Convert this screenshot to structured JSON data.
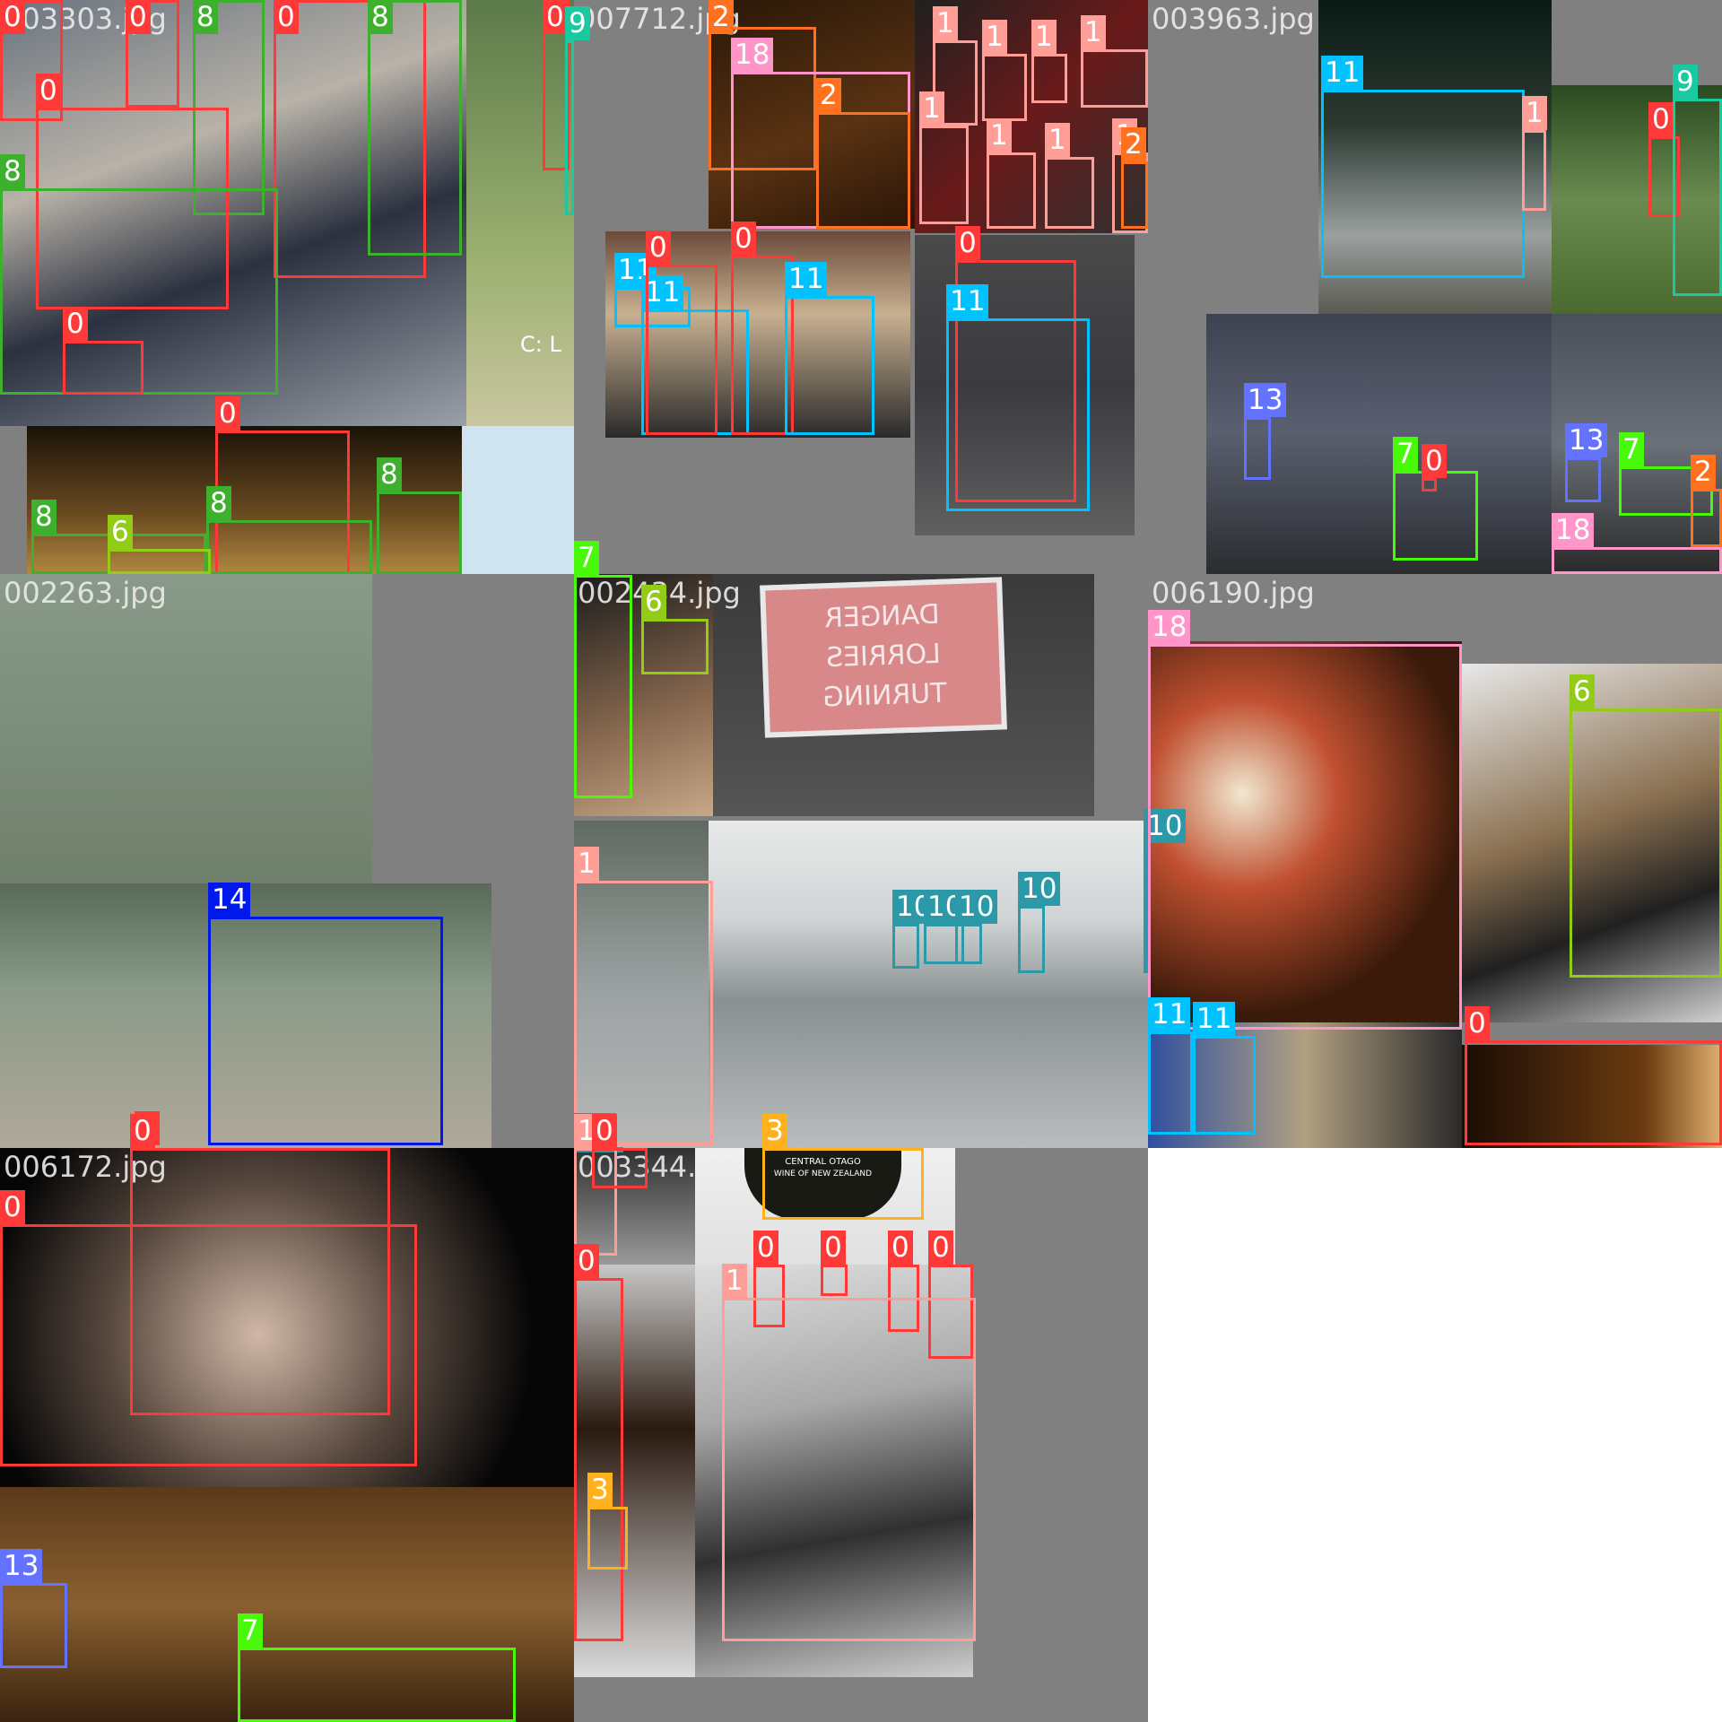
{
  "grid": {
    "tiles": [
      {
        "id": "t1",
        "filename": "003303.jpg"
      },
      {
        "id": "t2",
        "filename": "007712.jpg"
      },
      {
        "id": "t3",
        "filename": "003963.jpg"
      },
      {
        "id": "t4",
        "filename": "002263.jpg"
      },
      {
        "id": "t5",
        "filename": "002434.jpg"
      },
      {
        "id": "t6",
        "filename": "006190.jpg"
      },
      {
        "id": "t7",
        "filename": "006172.jpg"
      },
      {
        "id": "t8",
        "filename": "003344.jpg"
      }
    ]
  },
  "photo_text": {
    "sign_line1": "DANGER",
    "sign_line2": "LORRIES",
    "sign_line3": "TURNING",
    "bottle_line1": "CENTRAL OTAGO",
    "bottle_line2": "WINE OF NEW ZEALAND",
    "fence_text": "C: L"
  },
  "class_colors": {
    "0": "#ff3838",
    "1": "#ff9d97",
    "2": "#ff701f",
    "3": "#ffb21d",
    "6": "#92cc17",
    "7": "#48f90a",
    "8": "#3db12e",
    "9": "#1ac9a0",
    "10": "#2c99a8",
    "11": "#00c2ff",
    "13": "#6473ff",
    "14": "#0018ec",
    "18": "#ff95c8"
  },
  "labels": {
    "l0": "0",
    "l1": "1",
    "l2": "2",
    "l3": "3",
    "l6": "6",
    "l7": "7",
    "l8": "8",
    "l9": "9",
    "l10": "10",
    "l11": "11",
    "l13": "13",
    "l14": "14",
    "l18": "18"
  }
}
